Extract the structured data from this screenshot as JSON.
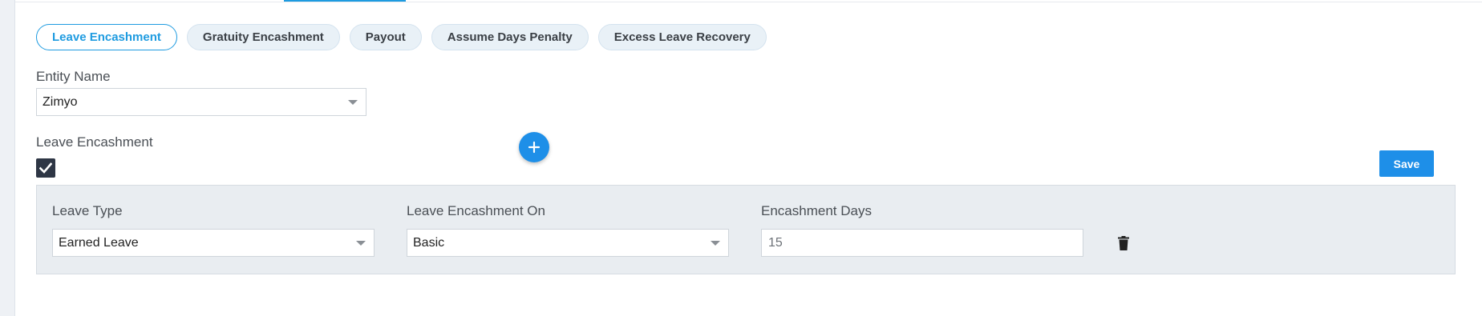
{
  "tabs": [
    {
      "label": "Leave Encashment",
      "active": true
    },
    {
      "label": "Gratuity Encashment",
      "active": false
    },
    {
      "label": "Payout",
      "active": false
    },
    {
      "label": "Assume Days Penalty",
      "active": false
    },
    {
      "label": "Excess Leave Recovery",
      "active": false
    }
  ],
  "entity": {
    "label": "Entity Name",
    "value": "Zimyo"
  },
  "leave_encashment": {
    "label": "Leave Encashment",
    "checked": true
  },
  "save_label": "Save",
  "row": {
    "leave_type_label": "Leave Type",
    "leave_type_value": "Earned Leave",
    "encashment_on_label": "Leave Encashment On",
    "encashment_on_value": "Basic",
    "days_label": "Encashment Days",
    "days_value": "15"
  },
  "colors": {
    "accent": "#1e9be0",
    "button": "#1e8fe8",
    "checkbox": "#2e3645",
    "row_bg": "#e9edf1"
  },
  "icons": {
    "add": "plus-icon",
    "delete": "trash-icon",
    "check": "check-icon",
    "dropdown": "chevron-down-icon"
  }
}
